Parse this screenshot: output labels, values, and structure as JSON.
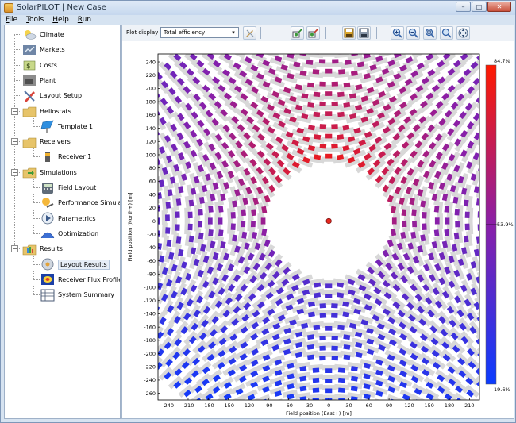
{
  "window": {
    "title": "SolarPILOT  |  New Case",
    "minimize_glyph": "–",
    "maximize_glyph": "□",
    "close_glyph": "✕"
  },
  "menu": [
    "File",
    "Tools",
    "Help",
    "Run"
  ],
  "sidebar": {
    "items": [
      {
        "label": "Climate",
        "icon": "climate-icon",
        "level": 1
      },
      {
        "label": "Markets",
        "icon": "markets-icon",
        "level": 1
      },
      {
        "label": "Costs",
        "icon": "costs-icon",
        "level": 1
      },
      {
        "label": "Plant",
        "icon": "plant-icon",
        "level": 1
      },
      {
        "label": "Layout Setup",
        "icon": "layout-setup-icon",
        "level": 1
      },
      {
        "label": "Heliostats",
        "icon": "heliostats-icon",
        "level": 1,
        "expander": "−"
      },
      {
        "label": "Template 1",
        "icon": "heliostat-template-icon",
        "level": 2
      },
      {
        "label": "Receivers",
        "icon": "receivers-icon",
        "level": 1,
        "expander": "−"
      },
      {
        "label": "Receiver 1",
        "icon": "receiver-icon",
        "level": 2
      },
      {
        "label": "Simulations",
        "icon": "simulations-icon",
        "level": 1,
        "expander": "−"
      },
      {
        "label": "Field Layout",
        "icon": "field-layout-icon",
        "level": 2
      },
      {
        "label": "Performance Simulation",
        "icon": "performance-simulation-icon",
        "level": 2
      },
      {
        "label": "Parametrics",
        "icon": "parametrics-icon",
        "level": 2
      },
      {
        "label": "Optimization",
        "icon": "optimization-icon",
        "level": 2
      },
      {
        "label": "Results",
        "icon": "results-icon",
        "level": 1,
        "expander": "−"
      },
      {
        "label": "Layout Results",
        "icon": "layout-results-icon",
        "level": 2,
        "selected": true
      },
      {
        "label": "Receiver Flux Profile",
        "icon": "receiver-flux-profile-icon",
        "level": 2
      },
      {
        "label": "System Summary",
        "icon": "system-summary-icon",
        "level": 2
      }
    ]
  },
  "toolbar": {
    "plot_display_label": "Plot display",
    "plot_display_value": "Total efficiency",
    "select_arrow": "▾",
    "buttons": [
      "plot-options-icon",
      "export-layout-icon",
      "import-layout-icon",
      "save-icon",
      "save-as-icon",
      "zoom-in-icon",
      "zoom-out-icon",
      "zoom-fit-icon",
      "zoom-rect-icon",
      "pan-icon"
    ]
  },
  "chart_data": {
    "type": "scatter",
    "description_of_marks": "heliostat positions colored by total efficiency",
    "xlabel": "Field position (East+) [m]",
    "ylabel": "Field position (North+) [m]",
    "x_ticks": [
      -240,
      -210,
      -180,
      -150,
      -120,
      -90,
      -60,
      -30,
      0,
      30,
      60,
      90,
      120,
      150,
      180,
      210
    ],
    "y_ticks": [
      240,
      220,
      200,
      180,
      160,
      140,
      120,
      100,
      80,
      60,
      40,
      20,
      0,
      -20,
      -40,
      -60,
      -80,
      -100,
      -120,
      -140,
      -160,
      -180,
      -200,
      -220,
      -240,
      -260
    ],
    "xlim": [
      -255,
      225
    ],
    "ylim": [
      -270,
      252
    ],
    "receiver_position": {
      "x": 0,
      "y": 0
    },
    "colorbar": {
      "max_label": "84.7%",
      "mid_label": "53.9%",
      "min_label": "19.6%",
      "max": 84.7,
      "mid": 53.9,
      "min": 19.6,
      "colors": [
        "#ff1a00",
        "#8a1fa8",
        "#0b3cff"
      ]
    },
    "rings": [
      {
        "r": 98,
        "n": 36,
        "eff": [
          0.9,
          0.28
        ]
      },
      {
        "r": 113,
        "n": 41,
        "eff": [
          0.86,
          0.26
        ]
      },
      {
        "r": 128,
        "n": 47,
        "eff": [
          0.82,
          0.24
        ]
      },
      {
        "r": 143,
        "n": 52,
        "eff": [
          0.78,
          0.22
        ]
      },
      {
        "r": 162,
        "n": 56,
        "eff": [
          0.75,
          0.2
        ]
      },
      {
        "r": 177,
        "n": 62,
        "eff": [
          0.72,
          0.18
        ]
      },
      {
        "r": 192,
        "n": 67,
        "eff": [
          0.69,
          0.16
        ]
      },
      {
        "r": 207,
        "n": 72,
        "eff": [
          0.66,
          0.14
        ]
      },
      {
        "r": 226,
        "n": 74,
        "eff": [
          0.63,
          0.12
        ]
      },
      {
        "r": 241,
        "n": 79,
        "eff": [
          0.6,
          0.1
        ]
      },
      {
        "r": 256,
        "n": 84,
        "eff": [
          0.57,
          0.08
        ]
      },
      {
        "r": 271,
        "n": 89,
        "eff": [
          0.55,
          0.06
        ]
      },
      {
        "r": 290,
        "n": 92,
        "eff": [
          0.52,
          0.04
        ]
      },
      {
        "r": 305,
        "n": 97,
        "eff": [
          0.5,
          0.03
        ]
      },
      {
        "r": 320,
        "n": 101,
        "eff": [
          0.48,
          0.02
        ]
      },
      {
        "r": 335,
        "n": 106,
        "eff": [
          0.46,
          0.01
        ]
      }
    ]
  }
}
